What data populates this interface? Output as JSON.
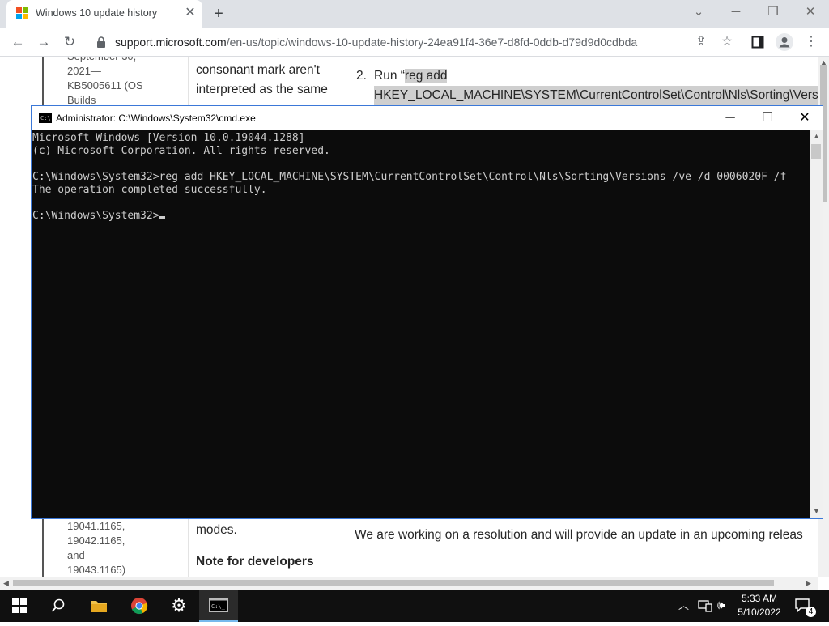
{
  "browser": {
    "tab_title": "Windows 10 update history",
    "tab_close": "✕",
    "new_tab": "+",
    "url_host": "support.microsoft.com",
    "url_path": "/en-us/topic/windows-10-update-history-24ea91f4-36e7-d8fd-0ddb-d79d9d0cdbda"
  },
  "page": {
    "left_top": [
      "September 30,",
      "2021—",
      "KB5005611 (OS",
      "Builds"
    ],
    "left_bottom": [
      "19041.1165,",
      "19042.1165,",
      "and",
      "19043.1165)"
    ],
    "mid_top": [
      "consonant mark aren't",
      "interpreted as the same"
    ],
    "mid_bottom": "modes.",
    "note_heading": "Note for developers",
    "step_number": "2.",
    "step_run": "Run “",
    "step_cmd1": "reg add",
    "step_cmd2": "HKEY_LOCAL_MACHINE\\SYSTEM\\CurrentControlSet\\Control\\Nls\\Sorting\\Vers",
    "resolution_text": "We are working on a resolution and will provide an update in an upcoming releas"
  },
  "cmd": {
    "title": "Administrator: C:\\Windows\\System32\\cmd.exe",
    "lines": [
      "Microsoft Windows [Version 10.0.19044.1288]",
      "(c) Microsoft Corporation. All rights reserved.",
      "",
      "C:\\Windows\\System32>reg add HKEY_LOCAL_MACHINE\\SYSTEM\\CurrentControlSet\\Control\\Nls\\Sorting\\Versions /ve /d 0006020F /f",
      "The operation completed successfully.",
      "",
      "C:\\Windows\\System32>"
    ]
  },
  "taskbar": {
    "time": "5:33 AM",
    "date": "5/10/2022",
    "notification_count": "4"
  },
  "colors": {
    "console_bg": "#0c0c0c",
    "console_fg": "#cccccc",
    "accent": "#3b78d8",
    "taskbar_bg": "#101010"
  },
  "icons": [
    "windows-logo-icon",
    "search-icon",
    "file-explorer-icon",
    "chrome-icon",
    "settings-gear-icon",
    "cmd-icon",
    "lock-icon",
    "share-icon",
    "star-icon",
    "sidepanel-icon",
    "profile-icon",
    "menu-icon",
    "back-icon",
    "forward-icon",
    "reload-icon",
    "network-icon",
    "volume-icon",
    "notification-icon"
  ]
}
